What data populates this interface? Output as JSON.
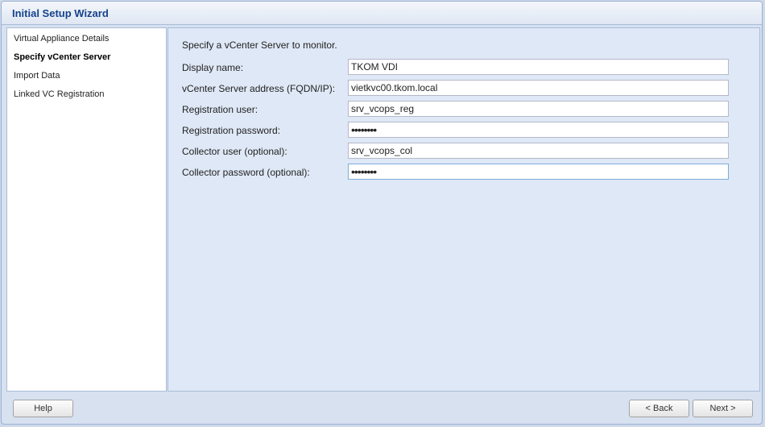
{
  "window": {
    "title": "Initial Setup Wizard"
  },
  "sidebar": {
    "items": [
      {
        "label": "Virtual Appliance Details",
        "active": false
      },
      {
        "label": "Specify vCenter Server",
        "active": true
      },
      {
        "label": "Import Data",
        "active": false
      },
      {
        "label": "Linked VC Registration",
        "active": false
      }
    ]
  },
  "form": {
    "intro": "Specify a vCenter Server to monitor.",
    "fields": [
      {
        "label": "Display name:",
        "value": "TKOM VDI"
      },
      {
        "label": "vCenter Server address (FQDN/IP):",
        "value": "vietkvc00.tkom.local"
      },
      {
        "label": "Registration user:",
        "value": "srv_vcops_reg"
      },
      {
        "label": "Registration password:",
        "value": "••••••••"
      },
      {
        "label": "Collector user (optional):",
        "value": "srv_vcops_col"
      },
      {
        "label": "Collector password (optional):",
        "value": "••••••••"
      }
    ]
  },
  "footer": {
    "help_label": "Help",
    "back_label": "< Back",
    "next_label": "Next >"
  }
}
